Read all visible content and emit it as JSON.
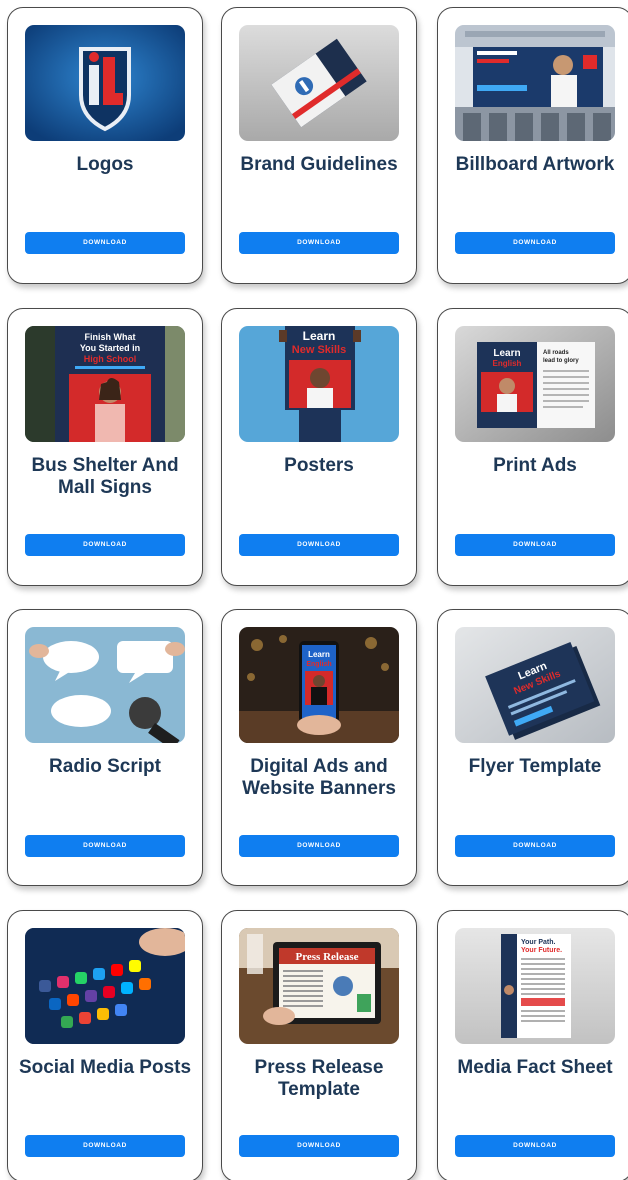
{
  "download_label": "DOWNLOAD",
  "accent": "#0f7ef0",
  "title_color": "#1e3856",
  "cards": [
    {
      "title": "Logos",
      "image": "il-logo-icon"
    },
    {
      "title": "Brand Guidelines",
      "image": "brand-guidelines-booklet"
    },
    {
      "title": "Billboard Artwork",
      "image": "billboard-on-building"
    },
    {
      "title": "Bus Shelter And Mall Signs",
      "image": "bus-shelter-sign",
      "image_text": [
        "Finish What",
        "You Started in",
        "High School"
      ]
    },
    {
      "title": "Posters",
      "image": "person-holding-poster",
      "image_text": [
        "Learn",
        "New Skills"
      ]
    },
    {
      "title": "Print Ads",
      "image": "magazine-print-ad",
      "image_text": [
        "Learn",
        "English",
        "All roads",
        "lead to glory"
      ]
    },
    {
      "title": "Radio Script",
      "image": "speech-bubbles-microphone"
    },
    {
      "title": "Digital Ads and Website Banners",
      "image": "phone-digital-ad",
      "image_text": [
        "Learn",
        "English"
      ]
    },
    {
      "title": "Flyer Template",
      "image": "flyer-stack",
      "image_text": [
        "Learn",
        "New Skills"
      ]
    },
    {
      "title": "Social Media Posts",
      "image": "phone-app-icons"
    },
    {
      "title": "Press Release Template",
      "image": "tablet-press-release",
      "image_text": [
        "Press Release"
      ]
    },
    {
      "title": "Media Fact Sheet",
      "image": "fact-sheet-document",
      "image_text": [
        "Your Path.",
        "Your Future."
      ]
    }
  ]
}
